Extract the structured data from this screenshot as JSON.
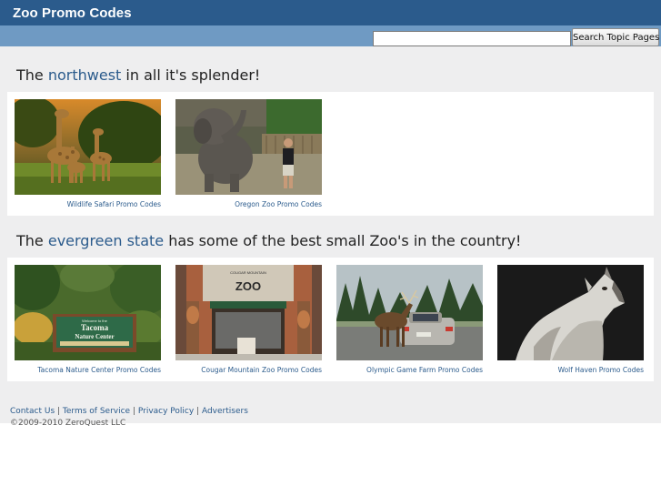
{
  "header": {
    "title": "Zoo Promo Codes"
  },
  "search": {
    "placeholder": "",
    "value": "",
    "button_label": "Search Topic Pages"
  },
  "section1": {
    "prefix": "The ",
    "link": "northwest",
    "suffix": " in all it's splender!",
    "items": [
      {
        "caption": "Wildlife Safari Promo Codes",
        "image": "giraffes-photo"
      },
      {
        "caption": "Oregon Zoo Promo Codes",
        "image": "elephant-photo"
      }
    ]
  },
  "section2": {
    "prefix": "The ",
    "link": "evergreen state",
    "suffix": " has some of the best small Zoo's in the country!",
    "items": [
      {
        "caption": "Tacoma Nature Center Promo Codes",
        "image": "nature-center-sign-photo",
        "sign_line1": "Welcome to the",
        "sign_line2": "Tacoma",
        "sign_line3": "Nature Center"
      },
      {
        "caption": "Cougar Mountain Zoo Promo Codes",
        "image": "zoo-storefront-photo",
        "sign_top": "COUGAR MOUNTAIN",
        "sign_main": "ZOO"
      },
      {
        "caption": "Olympic Game Farm Promo Codes",
        "image": "elk-and-car-photo"
      },
      {
        "caption": "Wolf Haven Promo Codes",
        "image": "howling-wolf-photo"
      }
    ]
  },
  "footer": {
    "links": [
      "Contact Us",
      "Terms of Service",
      "Privacy Policy",
      "Advertisers"
    ],
    "separator": " | ",
    "copyright": "©2009-2010 ZeroQuest LLC"
  },
  "colors": {
    "header_bg": "#2b5b8c",
    "toolbar_bg": "#6f9ac3",
    "link": "#2b5b8c",
    "page_bg": "#eeeeef"
  }
}
